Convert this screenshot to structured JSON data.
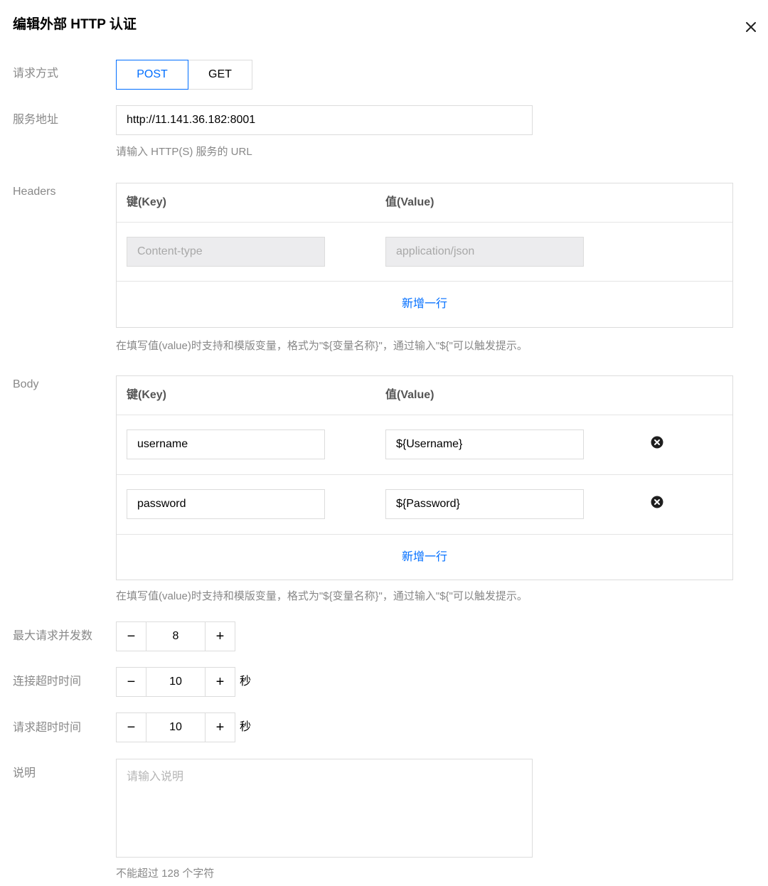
{
  "dialog": {
    "title": "编辑外部 HTTP 认证"
  },
  "method": {
    "label": "请求方式",
    "options": [
      "POST",
      "GET"
    ],
    "selected": "POST"
  },
  "service": {
    "label": "服务地址",
    "value": "http://11.141.36.182:8001",
    "hint": "请输入 HTTP(S) 服务的 URL"
  },
  "headers": {
    "label": "Headers",
    "key_header": "键(Key)",
    "value_header": "值(Value)",
    "rows": [
      {
        "key_placeholder": "Content-type",
        "value_placeholder": "application/json"
      }
    ],
    "add_label": "新增一行",
    "hint": "在填写值(value)时支持和模版变量，格式为\"${变量名称}\"，通过输入\"${\"可以触发提示。"
  },
  "body": {
    "label": "Body",
    "key_header": "键(Key)",
    "value_header": "值(Value)",
    "rows": [
      {
        "key": "username",
        "value": "${Username}"
      },
      {
        "key": "password",
        "value": "${Password}"
      }
    ],
    "add_label": "新增一行",
    "hint": "在填写值(value)时支持和模版变量，格式为\"${变量名称}\"，通过输入\"${\"可以触发提示。"
  },
  "concurrency": {
    "label": "最大请求并发数",
    "value": "8",
    "minus": "−",
    "plus": "+"
  },
  "connect_timeout": {
    "label": "连接超时时间",
    "value": "10",
    "unit": "秒",
    "minus": "−",
    "plus": "+"
  },
  "request_timeout": {
    "label": "请求超时时间",
    "value": "10",
    "unit": "秒",
    "minus": "−",
    "plus": "+"
  },
  "description": {
    "label": "说明",
    "placeholder": "请输入说明",
    "hint": "不能超过 128 个字符"
  },
  "colors": {
    "accent": "#006eff",
    "border": "#dcdcdc",
    "label": "#888888"
  }
}
